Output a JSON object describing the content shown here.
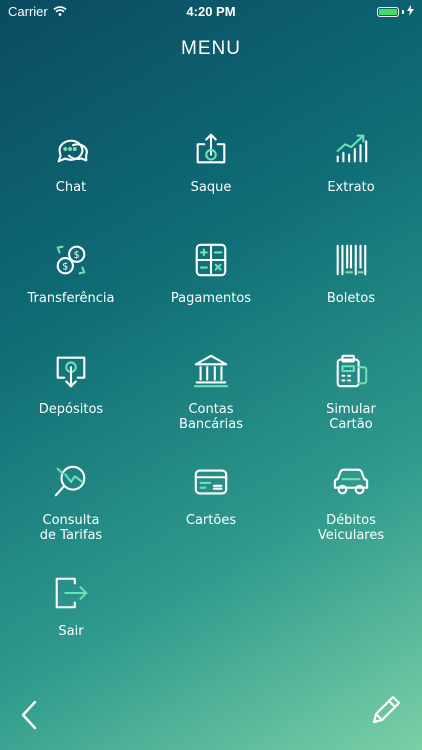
{
  "status_bar": {
    "carrier": "Carrier",
    "time": "4:20 PM",
    "battery_color": "#4cd964"
  },
  "header": {
    "title": "MENU"
  },
  "accent_color": "#ffffff",
  "icon_accent": "#6fe0b4",
  "menu": {
    "items": [
      {
        "label": "Chat",
        "icon": "chat-icon"
      },
      {
        "label": "Saque",
        "icon": "withdraw-icon"
      },
      {
        "label": "Extrato",
        "icon": "statement-chart-icon"
      },
      {
        "label": "Transferência",
        "icon": "transfer-icon"
      },
      {
        "label": "Pagamentos",
        "icon": "calculator-icon"
      },
      {
        "label": "Boletos",
        "icon": "barcode-icon"
      },
      {
        "label": "Depósitos",
        "icon": "deposit-icon"
      },
      {
        "label": "Contas\nBancárias",
        "icon": "bank-icon"
      },
      {
        "label": "Simular\nCartão",
        "icon": "card-simulator-icon"
      },
      {
        "label": "Consulta\nde Tarifas",
        "icon": "fee-search-icon"
      },
      {
        "label": "Cartões",
        "icon": "credit-card-icon"
      },
      {
        "label": "Débitos\nVeiculares",
        "icon": "car-icon"
      },
      {
        "label": "Sair",
        "icon": "logout-icon"
      }
    ]
  },
  "footer": {
    "back_icon": "chevron-left-icon",
    "edit_icon": "pencil-icon"
  }
}
